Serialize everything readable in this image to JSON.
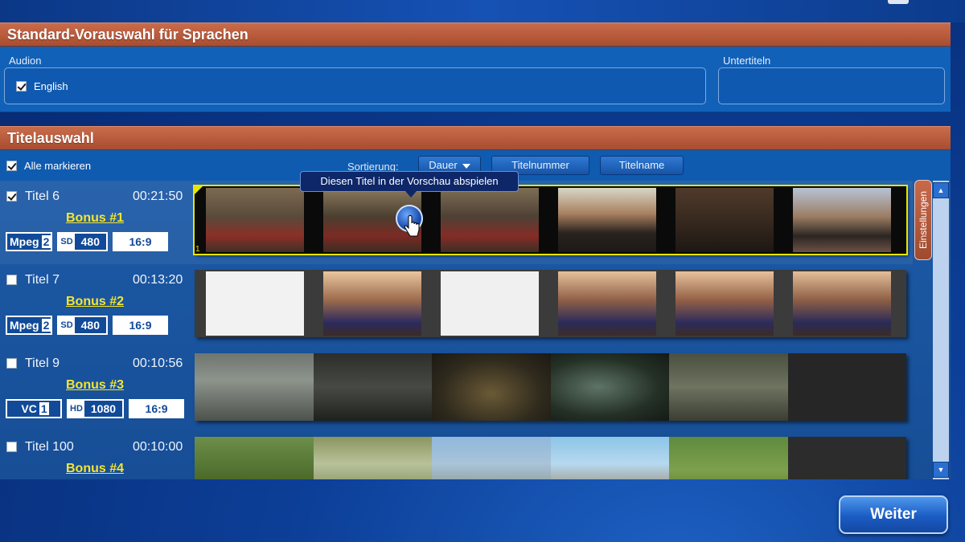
{
  "languages_section": {
    "title": "Standard-Vorauswahl für Sprachen",
    "audio_label": "Audion",
    "subtitles_label": "Untertiteln",
    "audio_items": [
      {
        "label": "English",
        "checked": true
      }
    ]
  },
  "titles_section": {
    "title": "Titelauswahl",
    "select_all_label": "Alle markieren",
    "select_all_checked": true,
    "sort_label": "Sortierung:",
    "sort_buttons": {
      "duration": "Dauer",
      "number": "Titelnummer",
      "name": "Titelname"
    },
    "tooltip": "Diesen Titel in der Vorschau abspielen",
    "settings_tab": "Einstellungen",
    "rows": [
      {
        "title": "Titel 6",
        "time": "00:21:50",
        "bonus": "Bonus #1",
        "checked": true,
        "codec": "Mpeg",
        "codec_suffix": "2",
        "res_tag": "SD",
        "res": "480",
        "aspect": "16:9",
        "frame_number": "1"
      },
      {
        "title": "Titel 7",
        "time": "00:13:20",
        "bonus": "Bonus #2",
        "checked": false,
        "codec": "Mpeg",
        "codec_suffix": "2",
        "res_tag": "SD",
        "res": "480",
        "aspect": "16:9"
      },
      {
        "title": "Titel 9",
        "time": "00:10:56",
        "bonus": "Bonus #3",
        "checked": false,
        "codec": "VC",
        "codec_suffix": "1",
        "res_tag": "HD",
        "res": "1080",
        "aspect": "16:9"
      },
      {
        "title": "Titel 100",
        "time": "00:10:00",
        "bonus": "Bonus #4",
        "checked": false
      }
    ]
  },
  "footer": {
    "next_label": "Weiter"
  },
  "colors": {
    "accent_header": "#b3573a",
    "panel": "#1161b8",
    "bonus_text": "#f5e52f",
    "highlight_frame": "#e7e600"
  }
}
